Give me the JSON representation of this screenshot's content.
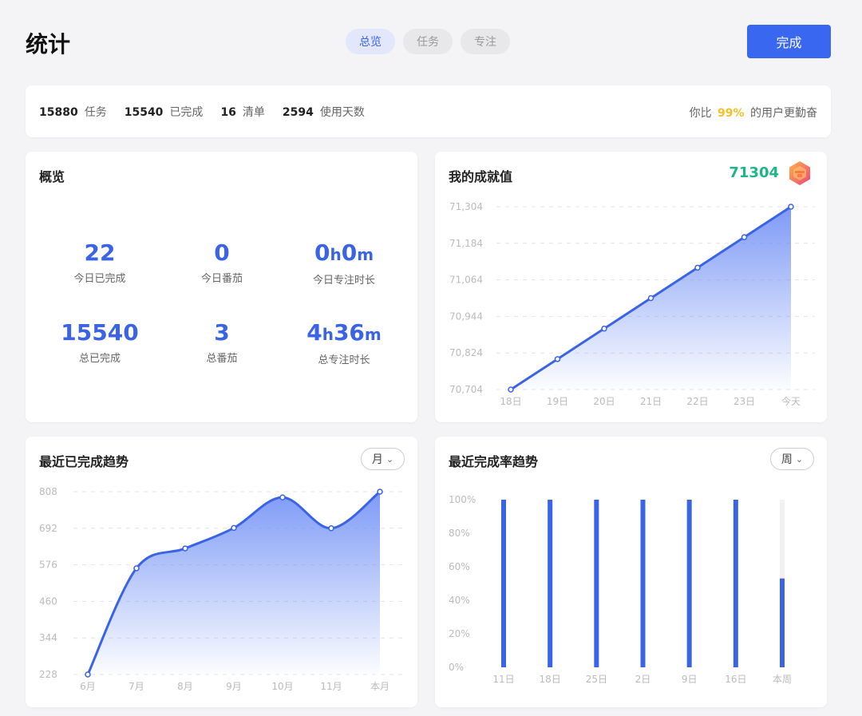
{
  "header": {
    "title": "统计",
    "tabs": [
      {
        "label": "总览",
        "active": true
      },
      {
        "label": "任务",
        "active": false
      },
      {
        "label": "专注",
        "active": false
      }
    ],
    "done_label": "完成"
  },
  "summary": {
    "items": [
      {
        "num": "15880",
        "label": "任务"
      },
      {
        "num": "15540",
        "label": "已完成"
      },
      {
        "num": "16",
        "label": "清单"
      },
      {
        "num": "2594",
        "label": "使用天数"
      }
    ],
    "compare_prefix": "你比",
    "compare_pct": "99%",
    "compare_suffix": "的用户更勤奋"
  },
  "overview": {
    "title": "概览",
    "cells": [
      {
        "value": "22",
        "label": "今日已完成"
      },
      {
        "value": "0",
        "label": "今日番茄"
      },
      {
        "value_parts": [
          "0",
          "h",
          "0",
          "m"
        ],
        "label": "今日专注时长"
      },
      {
        "value": "15540",
        "label": "总已完成"
      },
      {
        "value": "3",
        "label": "总番茄"
      },
      {
        "value_parts": [
          "4",
          "h",
          "36",
          "m"
        ],
        "label": "总专注时长"
      }
    ]
  },
  "achievement": {
    "title": "我的成就值",
    "value": "71304",
    "badge_icon": "achievement-badge-icon"
  },
  "trend": {
    "title": "最近已完成趋势",
    "range_label": "月"
  },
  "rate": {
    "title": "最近完成率趋势",
    "range_label": "周"
  },
  "colors": {
    "accent": "#3a63e6",
    "green": "#1db784",
    "gold": "#f3c12a"
  },
  "chart_data": [
    {
      "type": "area",
      "name": "achievement",
      "categories": [
        "18日",
        "19日",
        "20日",
        "21日",
        "22日",
        "23日",
        "今天"
      ],
      "values": [
        70704,
        70804,
        70904,
        71004,
        71104,
        71204,
        71304
      ],
      "yticks": [
        "70,704",
        "70,824",
        "70,944",
        "71,064",
        "71,184",
        "71,304"
      ],
      "ylim": [
        70704,
        71304
      ],
      "grid": true
    },
    {
      "type": "area",
      "name": "completed-trend",
      "categories": [
        "6月",
        "7月",
        "8月",
        "9月",
        "10月",
        "11月",
        "本月"
      ],
      "values": [
        228,
        565,
        628,
        693,
        790,
        692,
        808
      ],
      "yticks": [
        "228",
        "344",
        "460",
        "576",
        "692",
        "808"
      ],
      "ylim": [
        228,
        808
      ],
      "grid": true
    },
    {
      "type": "bar",
      "name": "completion-rate",
      "categories": [
        "11日",
        "18日",
        "25日",
        "2日",
        "9日",
        "16日",
        "本周"
      ],
      "values": [
        100,
        100,
        100,
        100,
        100,
        100,
        53
      ],
      "yticks": [
        "0%",
        "20%",
        "40%",
        "60%",
        "80%",
        "100%"
      ],
      "ylim": [
        0,
        100
      ],
      "grid": false
    }
  ]
}
